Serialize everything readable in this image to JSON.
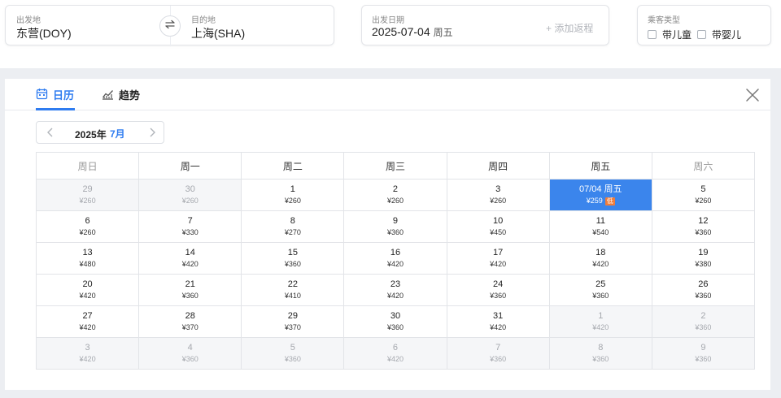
{
  "route": {
    "departure_label": "出发地",
    "departure_value": "东营(DOY)",
    "arrival_label": "目的地",
    "arrival_value": "上海(SHA)"
  },
  "date": {
    "label": "出发日期",
    "value": "2025-07-04",
    "weekday": "周五",
    "add_return": "+ 添加返程"
  },
  "passengers": {
    "label": "乘客类型",
    "options": [
      {
        "label": "带儿童",
        "checked": false
      },
      {
        "label": "带婴儿",
        "checked": false
      }
    ]
  },
  "tabs": [
    {
      "label": "日历",
      "active": true
    },
    {
      "label": "趋势",
      "active": false
    }
  ],
  "month_nav": {
    "year": "2025年",
    "month": "7月"
  },
  "colors": {
    "accent": "#2f7cf0",
    "selected_bg": "#3b85ec",
    "low_badge": "#f07c3a"
  },
  "calendar": {
    "headers": [
      "周日",
      "周一",
      "周二",
      "周三",
      "周四",
      "周五",
      "周六"
    ],
    "weeks": [
      [
        {
          "day": "29",
          "price": "¥260",
          "other": true
        },
        {
          "day": "30",
          "price": "¥260",
          "other": true
        },
        {
          "day": "1",
          "price": "¥260"
        },
        {
          "day": "2",
          "price": "¥260"
        },
        {
          "day": "3",
          "price": "¥260"
        },
        {
          "day": "07/04 周五",
          "price": "¥259",
          "selected": true,
          "badge": "低"
        },
        {
          "day": "5",
          "price": "¥260"
        }
      ],
      [
        {
          "day": "6",
          "price": "¥260"
        },
        {
          "day": "7",
          "price": "¥330"
        },
        {
          "day": "8",
          "price": "¥270"
        },
        {
          "day": "9",
          "price": "¥360"
        },
        {
          "day": "10",
          "price": "¥450"
        },
        {
          "day": "11",
          "price": "¥540"
        },
        {
          "day": "12",
          "price": "¥360"
        }
      ],
      [
        {
          "day": "13",
          "price": "¥480"
        },
        {
          "day": "14",
          "price": "¥420"
        },
        {
          "day": "15",
          "price": "¥360"
        },
        {
          "day": "16",
          "price": "¥420"
        },
        {
          "day": "17",
          "price": "¥420"
        },
        {
          "day": "18",
          "price": "¥420"
        },
        {
          "day": "19",
          "price": "¥380"
        }
      ],
      [
        {
          "day": "20",
          "price": "¥420"
        },
        {
          "day": "21",
          "price": "¥360"
        },
        {
          "day": "22",
          "price": "¥410"
        },
        {
          "day": "23",
          "price": "¥420"
        },
        {
          "day": "24",
          "price": "¥360"
        },
        {
          "day": "25",
          "price": "¥360"
        },
        {
          "day": "26",
          "price": "¥360"
        }
      ],
      [
        {
          "day": "27",
          "price": "¥420"
        },
        {
          "day": "28",
          "price": "¥370"
        },
        {
          "day": "29",
          "price": "¥370"
        },
        {
          "day": "30",
          "price": "¥360"
        },
        {
          "day": "31",
          "price": "¥420"
        },
        {
          "day": "1",
          "price": "¥420",
          "other": true
        },
        {
          "day": "2",
          "price": "¥360",
          "other": true
        }
      ],
      [
        {
          "day": "3",
          "price": "¥420",
          "other": true
        },
        {
          "day": "4",
          "price": "¥360",
          "other": true
        },
        {
          "day": "5",
          "price": "¥360",
          "other": true
        },
        {
          "day": "6",
          "price": "¥420",
          "other": true
        },
        {
          "day": "7",
          "price": "¥360",
          "other": true
        },
        {
          "day": "8",
          "price": "¥360",
          "other": true
        },
        {
          "day": "9",
          "price": "¥360",
          "other": true
        }
      ]
    ]
  }
}
